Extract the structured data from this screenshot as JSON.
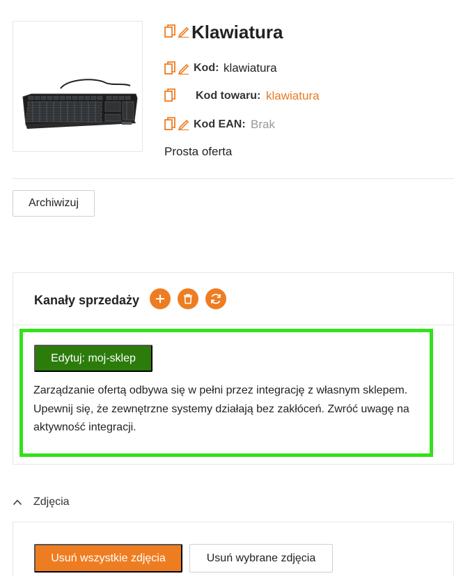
{
  "product": {
    "title": "Klawiatura",
    "image_alt": "keyboard-product-image",
    "fields": {
      "code_label": "Kod:",
      "code_value": "klawiatura",
      "product_code_label": "Kod towaru:",
      "product_code_value": "klawiatura",
      "ean_label": "Kod EAN:",
      "ean_value": "Brak"
    },
    "offer_type": "Prosta oferta"
  },
  "actions": {
    "archive_label": "Archiwizuj"
  },
  "sales_channels": {
    "title": "Kanały sprzedaży",
    "edit_button_label": "Edytuj: moj-sklep",
    "description": "Zarządzanie ofertą odbywa się w pełni przez integrację z własnym sklepem. Upewnij się, że zewnętrzne systemy działają bez zakłóceń. Zwróć uwagę na aktywność integracji."
  },
  "photos": {
    "section_label": "Zdjęcia",
    "delete_all_label": "Usuń wszystkie zdjęcia",
    "delete_selected_label": "Usuń wybrane zdjęcia"
  },
  "colors": {
    "accent_orange": "#ee7d22",
    "link_orange": "#e87a1f",
    "primary_green": "#2c7c0c",
    "highlight_green": "#33e01b",
    "muted_text": "#999999"
  }
}
